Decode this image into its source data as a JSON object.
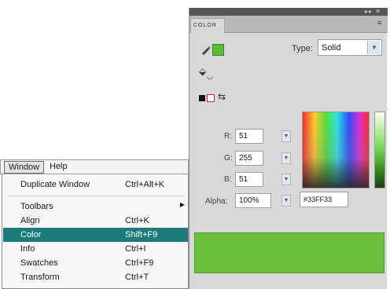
{
  "color_panel": {
    "tab_label": "COLOR",
    "type_label": "Type:",
    "type_value": "Solid",
    "channels": [
      {
        "label": "R:",
        "value": "51"
      },
      {
        "label": "G:",
        "value": "255"
      },
      {
        "label": "B:",
        "value": "51"
      }
    ],
    "alpha_label": "Alpha:",
    "alpha_value": "100%",
    "hex_value": "#33FF33",
    "colors": {
      "fill": "#5bbf34",
      "preview": "#6cbf3a"
    }
  },
  "menubar": {
    "items": [
      {
        "label": "Window"
      },
      {
        "label": "Help"
      }
    ]
  },
  "window_menu": {
    "items": [
      {
        "label": "Duplicate Window",
        "shortcut": "Ctrl+Alt+K"
      },
      {
        "label": "Toolbars",
        "shortcut": ""
      },
      {
        "label": "Align",
        "shortcut": "Ctrl+K"
      },
      {
        "label": "Color",
        "shortcut": "Shift+F9"
      },
      {
        "label": "Info",
        "shortcut": "Ctrl+I"
      },
      {
        "label": "Swatches",
        "shortcut": "Ctrl+F9"
      },
      {
        "label": "Transform",
        "shortcut": "Ctrl+T"
      }
    ],
    "highlighted_item": "Color",
    "highlight_color": "#1c7b7a"
  }
}
